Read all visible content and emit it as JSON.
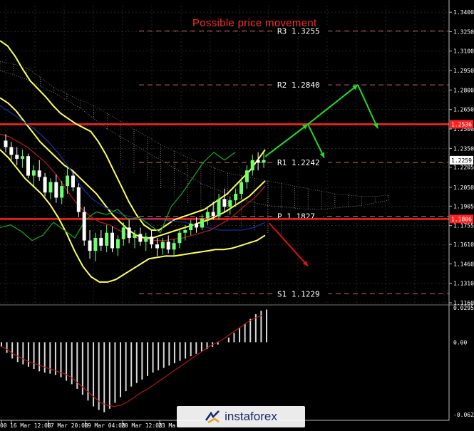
{
  "colors": {
    "background": "#000000",
    "grid": "#3a3a3a",
    "axis_text": "#ffffff",
    "candle_up": "#6bff6b",
    "candle_down": "#ffffff",
    "bollinger": "#ffff55",
    "ma_red": "#b01818",
    "ma_blue": "#1a2a9a",
    "chikou": "#18a018",
    "level_line": "#ff2020",
    "pivot_line": "#cc6666",
    "forecast_up": "#22dd22",
    "forecast_down": "#dd1111",
    "cloud": "#cccccc",
    "macd_hist": "#d8d8d8",
    "macd_signal": "#b01818"
  },
  "annotation": {
    "title": "Possible price movement"
  },
  "price_axis": {
    "ticks": [
      "1.3400",
      "1.3250",
      "1.3100",
      "1.2950",
      "1.2800",
      "1.2650",
      "1.2500",
      "1.2350",
      "1.2205",
      "1.2050",
      "1.1905",
      "1.1755",
      "1.1610",
      "1.1460",
      "1.1310",
      "1.1160"
    ],
    "flags": [
      {
        "label": "1.2536",
        "value": 1.2536
      },
      {
        "label": "1.2259",
        "value": 1.2259
      },
      {
        "label": "1.1806",
        "value": 1.1806
      }
    ]
  },
  "macd_axis": {
    "ticks": [
      "0.02954",
      "0.00",
      "-0.06205"
    ]
  },
  "time_axis": {
    "ticks": [
      "00",
      "16 Mar 12:00",
      "17 Mar 20:00",
      "19 Mar 04:00",
      "20 Mar 12:00",
      "23 Ma"
    ]
  },
  "chart_data": {
    "type": "line",
    "title": "Possible price movement",
    "ylim": [
      1.116,
      1.345
    ],
    "levels": [
      {
        "name": "R3",
        "label": "R3 1.3255",
        "value": 1.3255
      },
      {
        "name": "R2",
        "label": "R2 1.2840",
        "value": 1.284
      },
      {
        "name": "R1",
        "label": "R1 1.2242",
        "value": 1.2242
      },
      {
        "name": "P",
        "label": "P 1.1827",
        "value": 1.1827
      },
      {
        "name": "S1",
        "label": "S1 1.1229",
        "value": 1.1229
      }
    ],
    "red_levels": [
      1.2536,
      1.1806
    ],
    "candles": [
      [
        1.241,
        1.246,
        1.232,
        1.236
      ],
      [
        1.236,
        1.24,
        1.226,
        1.23
      ],
      [
        1.23,
        1.236,
        1.222,
        1.227
      ],
      [
        1.227,
        1.234,
        1.22,
        1.229
      ],
      [
        1.229,
        1.231,
        1.212,
        1.214
      ],
      [
        1.214,
        1.222,
        1.206,
        1.218
      ],
      [
        1.218,
        1.226,
        1.21,
        1.213
      ],
      [
        1.213,
        1.216,
        1.198,
        1.201
      ],
      [
        1.201,
        1.212,
        1.196,
        1.209
      ],
      [
        1.209,
        1.215,
        1.193,
        1.197
      ],
      [
        1.197,
        1.21,
        1.192,
        1.206
      ],
      [
        1.206,
        1.22,
        1.2,
        1.214
      ],
      [
        1.214,
        1.218,
        1.202,
        1.205
      ],
      [
        1.205,
        1.208,
        1.182,
        1.186
      ],
      [
        1.186,
        1.19,
        1.16,
        1.164
      ],
      [
        1.164,
        1.172,
        1.15,
        1.156
      ],
      [
        1.156,
        1.17,
        1.148,
        1.166
      ],
      [
        1.166,
        1.172,
        1.156,
        1.16
      ],
      [
        1.16,
        1.176,
        1.155,
        1.17
      ],
      [
        1.17,
        1.175,
        1.155,
        1.158
      ],
      [
        1.158,
        1.168,
        1.152,
        1.165
      ],
      [
        1.165,
        1.178,
        1.16,
        1.174
      ],
      [
        1.174,
        1.18,
        1.162,
        1.166
      ],
      [
        1.166,
        1.172,
        1.158,
        1.169
      ],
      [
        1.169,
        1.174,
        1.16,
        1.163
      ],
      [
        1.163,
        1.17,
        1.156,
        1.167
      ],
      [
        1.167,
        1.172,
        1.158,
        1.161
      ],
      [
        1.161,
        1.166,
        1.152,
        1.158
      ],
      [
        1.158,
        1.166,
        1.153,
        1.163
      ],
      [
        1.163,
        1.168,
        1.154,
        1.157
      ],
      [
        1.157,
        1.165,
        1.152,
        1.162
      ],
      [
        1.162,
        1.172,
        1.158,
        1.17
      ],
      [
        1.17,
        1.176,
        1.164,
        1.172
      ],
      [
        1.172,
        1.18,
        1.168,
        1.177
      ],
      [
        1.177,
        1.182,
        1.17,
        1.174
      ],
      [
        1.174,
        1.184,
        1.172,
        1.181
      ],
      [
        1.181,
        1.19,
        1.176,
        1.186
      ],
      [
        1.186,
        1.194,
        1.18,
        1.183
      ],
      [
        1.183,
        1.2,
        1.18,
        1.196
      ],
      [
        1.196,
        1.204,
        1.186,
        1.19
      ],
      [
        1.19,
        1.198,
        1.184,
        1.195
      ],
      [
        1.195,
        1.204,
        1.19,
        1.2
      ],
      [
        1.2,
        1.212,
        1.196,
        1.209
      ],
      [
        1.209,
        1.222,
        1.204,
        1.218
      ],
      [
        1.218,
        1.23,
        1.214,
        1.226
      ],
      [
        1.226,
        1.232,
        1.218,
        1.224
      ],
      [
        1.224,
        1.232,
        1.22,
        1.226
      ]
    ],
    "series": [
      {
        "kind": "bollinger",
        "values": [
          1.318,
          1.314,
          1.306,
          1.296,
          1.287,
          1.281,
          1.275,
          1.268,
          1.262,
          1.258,
          1.254,
          1.251,
          1.248,
          1.24,
          1.23,
          1.218,
          1.206,
          1.194,
          1.184,
          1.176,
          1.172,
          1.172,
          1.176,
          1.18,
          1.182,
          1.184,
          1.186,
          1.188,
          1.192,
          1.196,
          1.2,
          1.206,
          1.212,
          1.218,
          1.226,
          1.234
        ]
      },
      {
        "kind": "bollinger",
        "values": [
          1.274,
          1.27,
          1.264,
          1.256,
          1.248,
          1.24,
          1.234,
          1.228,
          1.222,
          1.218,
          1.212,
          1.206,
          1.2,
          1.192,
          1.184,
          1.178,
          1.172,
          1.168,
          1.166,
          1.166,
          1.168,
          1.17,
          1.172,
          1.174,
          1.176,
          1.178,
          1.18,
          1.183,
          1.186,
          1.19,
          1.194,
          1.198,
          1.204,
          1.21
        ]
      },
      {
        "kind": "bollinger",
        "values": [
          1.234,
          1.228,
          1.22,
          1.212,
          1.206,
          1.2,
          1.192,
          1.182,
          1.17,
          1.156,
          1.144,
          1.136,
          1.132,
          1.132,
          1.134,
          1.138,
          1.142,
          1.146,
          1.15,
          1.151,
          1.152,
          1.152,
          1.153,
          1.154,
          1.155,
          1.156,
          1.157,
          1.157,
          1.158,
          1.16,
          1.162,
          1.164,
          1.168
        ]
      },
      {
        "kind": "ma",
        "color": "ma_red",
        "values": [
          1.246,
          1.244,
          1.24,
          1.236,
          1.23,
          1.224,
          1.216,
          1.206,
          1.196,
          1.188,
          1.182,
          1.178,
          1.176,
          1.172,
          1.168,
          1.166,
          1.165,
          1.164,
          1.164,
          1.165,
          1.166,
          1.168,
          1.17,
          1.172,
          1.176,
          1.18,
          1.186,
          1.192,
          1.198,
          1.206
        ]
      },
      {
        "kind": "ma",
        "color": "ma_blue",
        "values": [
          1.268,
          1.262,
          1.256,
          1.25,
          1.242,
          1.232,
          1.22,
          1.206,
          1.196,
          1.19,
          1.186,
          1.183,
          1.181,
          1.18,
          1.18,
          1.179,
          1.178,
          1.176,
          1.174,
          1.172,
          1.172,
          1.172,
          1.174,
          1.178
        ]
      },
      {
        "kind": "chikou",
        "color": "chikou",
        "values": [
          1.174,
          1.176,
          1.171,
          1.164,
          1.168,
          1.178,
          1.172,
          1.166,
          1.18,
          1.186,
          1.184,
          1.188,
          1.18,
          1.182,
          1.176,
          1.17,
          1.19,
          1.2,
          1.212,
          1.224,
          1.232,
          1.226,
          1.232
        ]
      }
    ],
    "cloud": {
      "upper": [
        1.302,
        1.3,
        1.297,
        1.29,
        1.282,
        1.277,
        1.272,
        1.268,
        1.262,
        1.256,
        1.25,
        1.244,
        1.238,
        1.233,
        1.228,
        1.224,
        1.22,
        1.216,
        1.214,
        1.212,
        1.21,
        1.208,
        1.206,
        1.204,
        1.202,
        1.2,
        1.199,
        1.198,
        1.198,
        1.199
      ],
      "lower": [
        1.295,
        1.292,
        1.288,
        1.283,
        1.278,
        1.272,
        1.266,
        1.258,
        1.25,
        1.244,
        1.238,
        1.232,
        1.226,
        1.22,
        1.214,
        1.208,
        1.204,
        1.2,
        1.196,
        1.193,
        1.191,
        1.19,
        1.189,
        1.188,
        1.188,
        1.189,
        1.19,
        1.191,
        1.193,
        1.195
      ]
    },
    "forecast_up": [
      [
        1.2259,
        1.2536
      ],
      [
        1.2536,
        1.242
      ],
      [
        1.2536,
        1.284
      ],
      [
        1.284,
        1.268
      ]
    ],
    "forecast_down": [
      [
        1.1806,
        1.152
      ]
    ],
    "macd": {
      "ylim": [
        -0.06205,
        0.02954
      ],
      "histogram": [
        -0.004,
        -0.009,
        -0.014,
        -0.017,
        -0.019,
        -0.021,
        -0.023,
        -0.025,
        -0.026,
        -0.027,
        -0.028,
        -0.03,
        -0.033,
        -0.036,
        -0.04,
        -0.045,
        -0.05,
        -0.055,
        -0.058,
        -0.06,
        -0.057,
        -0.052,
        -0.047,
        -0.042,
        -0.038,
        -0.035,
        -0.032,
        -0.029,
        -0.026,
        -0.024,
        -0.022,
        -0.02,
        -0.018,
        -0.016,
        -0.014,
        -0.012,
        -0.01,
        -0.008,
        -0.006,
        -0.004,
        -0.002,
        0.0,
        0.004,
        0.008,
        0.012,
        0.016,
        0.02,
        0.024,
        0.027,
        0.028
      ],
      "signal": [
        -0.003,
        -0.006,
        -0.01,
        -0.013,
        -0.016,
        -0.018,
        -0.02,
        -0.022,
        -0.024,
        -0.026,
        -0.028,
        -0.032,
        -0.037,
        -0.042,
        -0.047,
        -0.052,
        -0.054,
        -0.055,
        -0.054,
        -0.051,
        -0.047,
        -0.043,
        -0.04,
        -0.036,
        -0.032,
        -0.028,
        -0.024,
        -0.02,
        -0.016,
        -0.012,
        -0.008,
        -0.004,
        -0.001,
        0.002,
        0.006,
        0.01,
        0.014,
        0.018,
        0.021,
        0.023
      ]
    }
  },
  "watermark": {
    "text": "instaforex"
  }
}
